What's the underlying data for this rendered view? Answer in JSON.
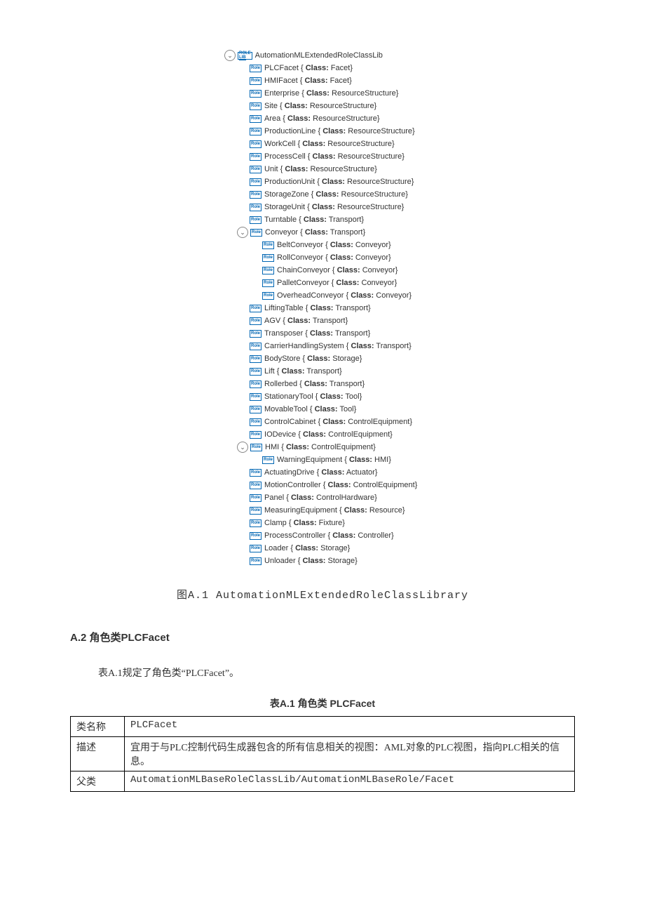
{
  "badges": {
    "lib": "ROLE",
    "lib_sub": "LIB",
    "role": "Role",
    "class_label": "Class:"
  },
  "chevron": "⌄",
  "tree": {
    "root": "AutomationMLExtendedRoleClassLib",
    "level1": [
      {
        "name": "PLCFacet",
        "class": "Facet",
        "expand": null
      },
      {
        "name": "HMIFacet",
        "class": "Facet",
        "expand": null
      },
      {
        "name": "Enterprise",
        "class": "ResourceStructure",
        "expand": null
      },
      {
        "name": "Site",
        "class": "ResourceStructure",
        "expand": null
      },
      {
        "name": "Area",
        "class": "ResourceStructure",
        "expand": null
      },
      {
        "name": "ProductionLine",
        "class": "ResourceStructure",
        "expand": null
      },
      {
        "name": "WorkCell",
        "class": "ResourceStructure",
        "expand": null
      },
      {
        "name": "ProcessCell",
        "class": "ResourceStructure",
        "expand": null
      },
      {
        "name": "Unit",
        "class": "ResourceStructure",
        "expand": null
      },
      {
        "name": "ProductionUnit",
        "class": "ResourceStructure",
        "expand": null
      },
      {
        "name": "StorageZone",
        "class": "ResourceStructure",
        "expand": null
      },
      {
        "name": "StorageUnit",
        "class": "ResourceStructure",
        "expand": null
      },
      {
        "name": "Turntable",
        "class": "Transport",
        "expand": null
      },
      {
        "name": "Conveyor",
        "class": "Transport",
        "expand": true,
        "children": [
          {
            "name": "BeltConveyor",
            "class": "Conveyor"
          },
          {
            "name": "RollConveyor",
            "class": "Conveyor"
          },
          {
            "name": "ChainConveyor",
            "class": "Conveyor"
          },
          {
            "name": "PalletConveyor",
            "class": "Conveyor"
          },
          {
            "name": "OverheadConveyor",
            "class": "Conveyor"
          }
        ]
      },
      {
        "name": "LiftingTable",
        "class": "Transport",
        "expand": null
      },
      {
        "name": "AGV",
        "class": "Transport",
        "expand": null
      },
      {
        "name": "Transposer",
        "class": "Transport",
        "expand": null
      },
      {
        "name": "CarrierHandlingSystem",
        "class": "Transport",
        "expand": null
      },
      {
        "name": "BodyStore",
        "class": "Storage",
        "expand": null
      },
      {
        "name": "Lift",
        "class": "Transport",
        "expand": null
      },
      {
        "name": "Rollerbed",
        "class": "Transport",
        "expand": null
      },
      {
        "name": "StationaryTool",
        "class": "Tool",
        "expand": null
      },
      {
        "name": "MovableTool",
        "class": "Tool",
        "expand": null
      },
      {
        "name": "ControlCabinet",
        "class": "ControlEquipment",
        "expand": null
      },
      {
        "name": "IODevice",
        "class": "ControlEquipment",
        "expand": null
      },
      {
        "name": "HMI",
        "class": "ControlEquipment",
        "expand": true,
        "children": [
          {
            "name": "WarningEquipment",
            "class": "HMI"
          }
        ]
      },
      {
        "name": "ActuatingDrive",
        "class": "Actuator",
        "expand": null
      },
      {
        "name": "MotionController",
        "class": "ControlEquipment",
        "expand": null
      },
      {
        "name": "Panel",
        "class": "ControlHardware",
        "expand": null
      },
      {
        "name": "MeasuringEquipment",
        "class": "Resource",
        "expand": null
      },
      {
        "name": "Clamp",
        "class": "Fixture",
        "expand": null
      },
      {
        "name": "ProcessController",
        "class": "Controller",
        "expand": null
      },
      {
        "name": "Loader",
        "class": "Storage",
        "expand": null
      },
      {
        "name": "Unloader",
        "class": "Storage",
        "expand": null
      }
    ]
  },
  "figure_caption": "图A.1  AutomationMLExtendedRoleClassLibrary",
  "section_heading": "A.2  角色类PLCFacet",
  "paragraph": "表A.1规定了角色类“PLCFacet”。",
  "table_caption": "表A.1  角色类 PLCFacet",
  "table_rows": [
    {
      "key": "类名称",
      "value": "PLCFacet"
    },
    {
      "key": "描述",
      "value": "宜用于与PLC控制代码生成器包含的所有信息相关的视图：AML对象的PLC视图，指向PLC相关的信息。"
    },
    {
      "key": "父类",
      "value": "AutomationMLBaseRoleClassLib/AutomationMLBaseRole/Facet"
    }
  ]
}
